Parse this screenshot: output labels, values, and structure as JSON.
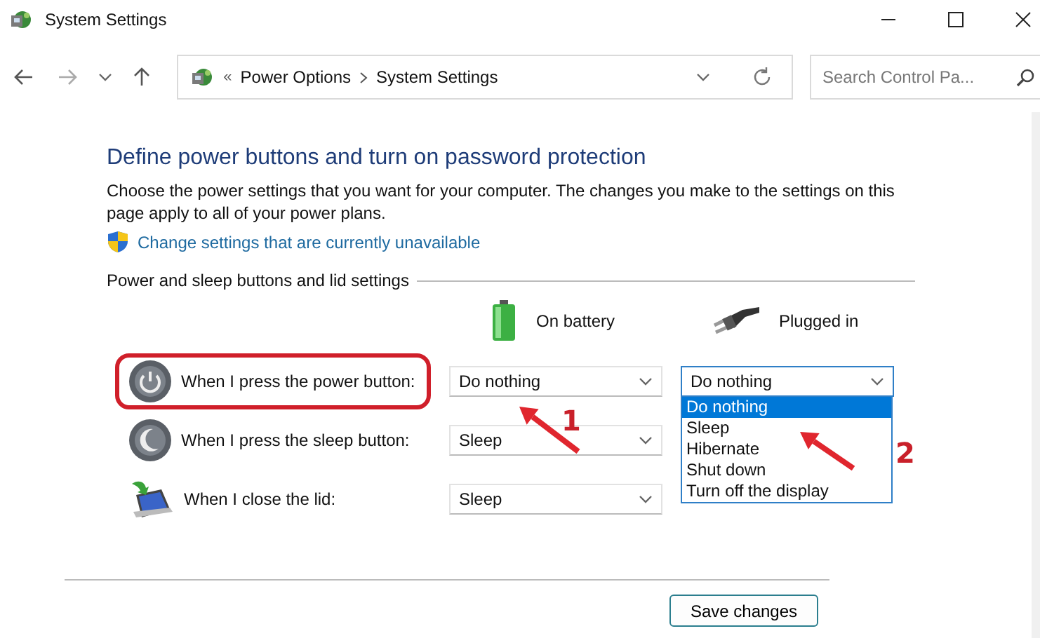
{
  "window": {
    "title": "System Settings"
  },
  "address_bar": {
    "overflow": "«",
    "crumbs": [
      "Power Options",
      "System Settings"
    ]
  },
  "search": {
    "placeholder": "Search Control Pa..."
  },
  "heading": "Define power buttons and turn on password protection",
  "description": "Choose the power settings that you want for your computer. The changes you make to the settings on this page apply to all of your power plans.",
  "link": "Change settings that are currently unavailable",
  "section": "Power and sleep buttons and lid settings",
  "columns": [
    {
      "kind": "battery",
      "label": "On battery"
    },
    {
      "kind": "plug",
      "label": "Plugged in"
    }
  ],
  "settings": [
    {
      "kind": "power",
      "label": "When I press the power button:",
      "highlighted": true,
      "values": [
        {
          "text": "Do nothing",
          "open": false
        },
        {
          "text": "Do nothing",
          "open": true
        }
      ]
    },
    {
      "kind": "sleep",
      "label": "When I press the sleep button:",
      "highlighted": false,
      "values": [
        {
          "text": "Sleep",
          "open": false
        }
      ]
    },
    {
      "kind": "lid",
      "label": "When I close the lid:",
      "highlighted": false,
      "values": [
        {
          "text": "Sleep",
          "open": false
        }
      ]
    }
  ],
  "dropdown": {
    "options": [
      {
        "label": "Do nothing",
        "selected": true
      },
      {
        "label": "Sleep",
        "selected": false
      },
      {
        "label": "Hibernate",
        "selected": false
      },
      {
        "label": "Shut down",
        "selected": false
      },
      {
        "label": "Turn off the display",
        "selected": false
      }
    ]
  },
  "annotations": [
    {
      "label": "1"
    },
    {
      "label": "2"
    }
  ],
  "buttons": [
    "Save changes"
  ]
}
